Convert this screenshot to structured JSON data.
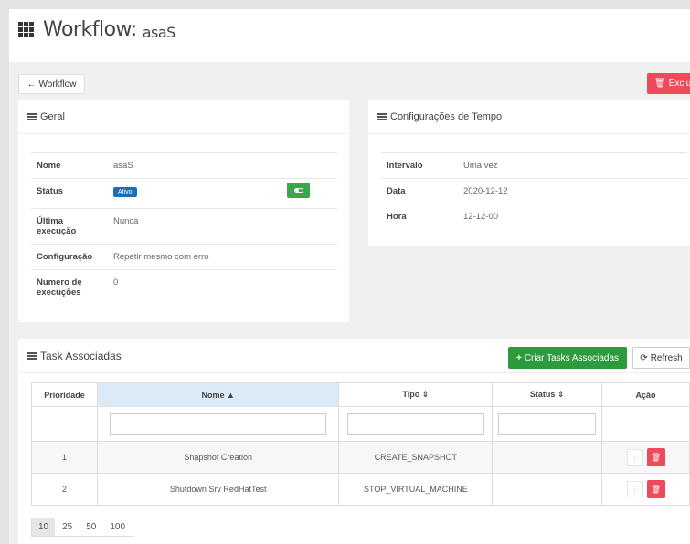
{
  "header": {
    "title": "Workflow:",
    "name": "asaS"
  },
  "toolbar": {
    "back_label": "Workflow",
    "delete_label": "Exclui"
  },
  "general": {
    "title": "Geral",
    "rows": [
      {
        "key": "Nome",
        "value": "asaS"
      },
      {
        "key": "Status",
        "value": "Ativo"
      },
      {
        "key": "Última execução",
        "value": "Nunca"
      },
      {
        "key": "Configuração",
        "value": "Repetir mesmo com erro"
      },
      {
        "key": "Numero de execuções",
        "value": "0"
      }
    ]
  },
  "time_config": {
    "title": "Configurações de Tempo",
    "rows": [
      {
        "key": "Intervalo",
        "value": "Uma vez"
      },
      {
        "key": "Data",
        "value": "2020-12-12"
      },
      {
        "key": "Hora",
        "value": "12-12-00"
      }
    ]
  },
  "tasks": {
    "title": "Task Associadas",
    "create_label": "Criar Tasks Associadas",
    "refresh_label": "Refresh",
    "columns": [
      "Prioridade",
      "Nome ▲",
      "Tipo ⇕",
      "Status ⇕",
      "Ação"
    ],
    "rows": [
      {
        "priority": "1",
        "name": "Snapshot Creation",
        "type": "CREATE_SNAPSHOT",
        "status": ""
      },
      {
        "priority": "2",
        "name": "Shutdown Srv RedHatTest",
        "type": "STOP_VIRTUAL_MACHINE",
        "status": ""
      }
    ]
  },
  "pager": {
    "options": [
      "10",
      "25",
      "50",
      "100"
    ],
    "selected": "10"
  },
  "colors": {
    "danger": "#ee4a5b",
    "success": "#2e9a3e",
    "primary": "#1b6fb8",
    "sorted_header": "#dbeaf7"
  }
}
